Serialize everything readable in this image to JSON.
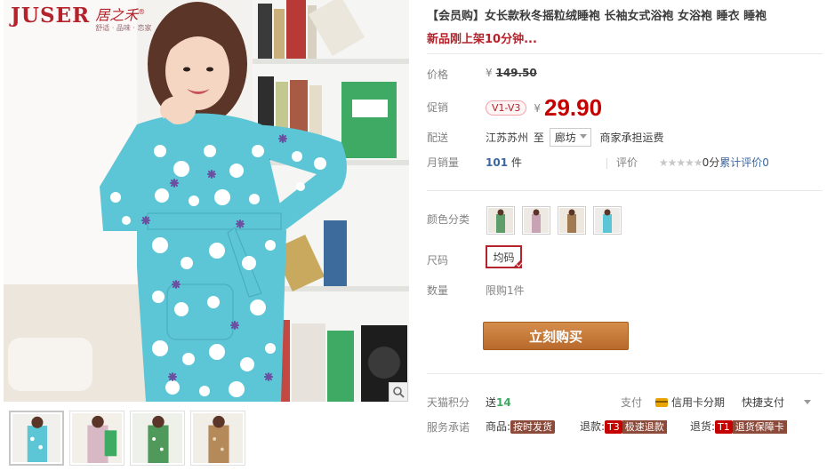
{
  "brand": {
    "name": "JUSER",
    "cn_name": "居之禾",
    "registered": "®",
    "slogan": "舒适 · 品味 · 恋家"
  },
  "product": {
    "title": "【会员购】女长款秋冬摇粒绒睡袍 长袖女式浴袍 女浴袍 睡衣 睡袍",
    "subtitle": "新品刚上架10分钟..."
  },
  "price": {
    "label": "价格",
    "currency": "¥",
    "original": "149.50"
  },
  "promo": {
    "label": "促销",
    "badge": "V1-V3",
    "currency": "¥",
    "price": "29.90"
  },
  "shipping": {
    "label": "配送",
    "from": "江苏苏州",
    "to_word": "至",
    "destination": "廊坊",
    "note": "商家承担运费"
  },
  "sales": {
    "label": "月销量",
    "count": "101",
    "unit": "件",
    "rating_label": "评价",
    "stars": "★★★★★",
    "rating_score": "0分",
    "total_label": "累计评价",
    "total_count": "0"
  },
  "options": {
    "color_label": "颜色分类",
    "size_label": "尺码",
    "size_value": "均码",
    "quantity_label": "数量",
    "quantity_note": "限购1件"
  },
  "actions": {
    "buy_label": "立刻购买"
  },
  "points": {
    "label": "天猫积分",
    "prefix": "送",
    "value": "14",
    "pay_label": "支付",
    "credit_label": "信用卡分期",
    "fast_pay_label": "快捷支付"
  },
  "service": {
    "label": "服务承诺",
    "item1_prefix": "商品:",
    "item1_tag": "按时发货",
    "item2_prefix": "退款:",
    "item2_code": "T3",
    "item2_tag": "极速退款",
    "item3_prefix": "退货:",
    "item3_code": "T1",
    "item3_tag": "退货保障卡"
  },
  "colors": {
    "accent_red": "#c40000",
    "brand_red": "#b4232b",
    "buy_button": "#c77c3c",
    "robe_teal": "#5cc6d6"
  },
  "icons": [
    "zoom-icon",
    "dropdown-caret-icon",
    "credit-card-icon",
    "selected-check-icon",
    "chevron-down-icon"
  ]
}
